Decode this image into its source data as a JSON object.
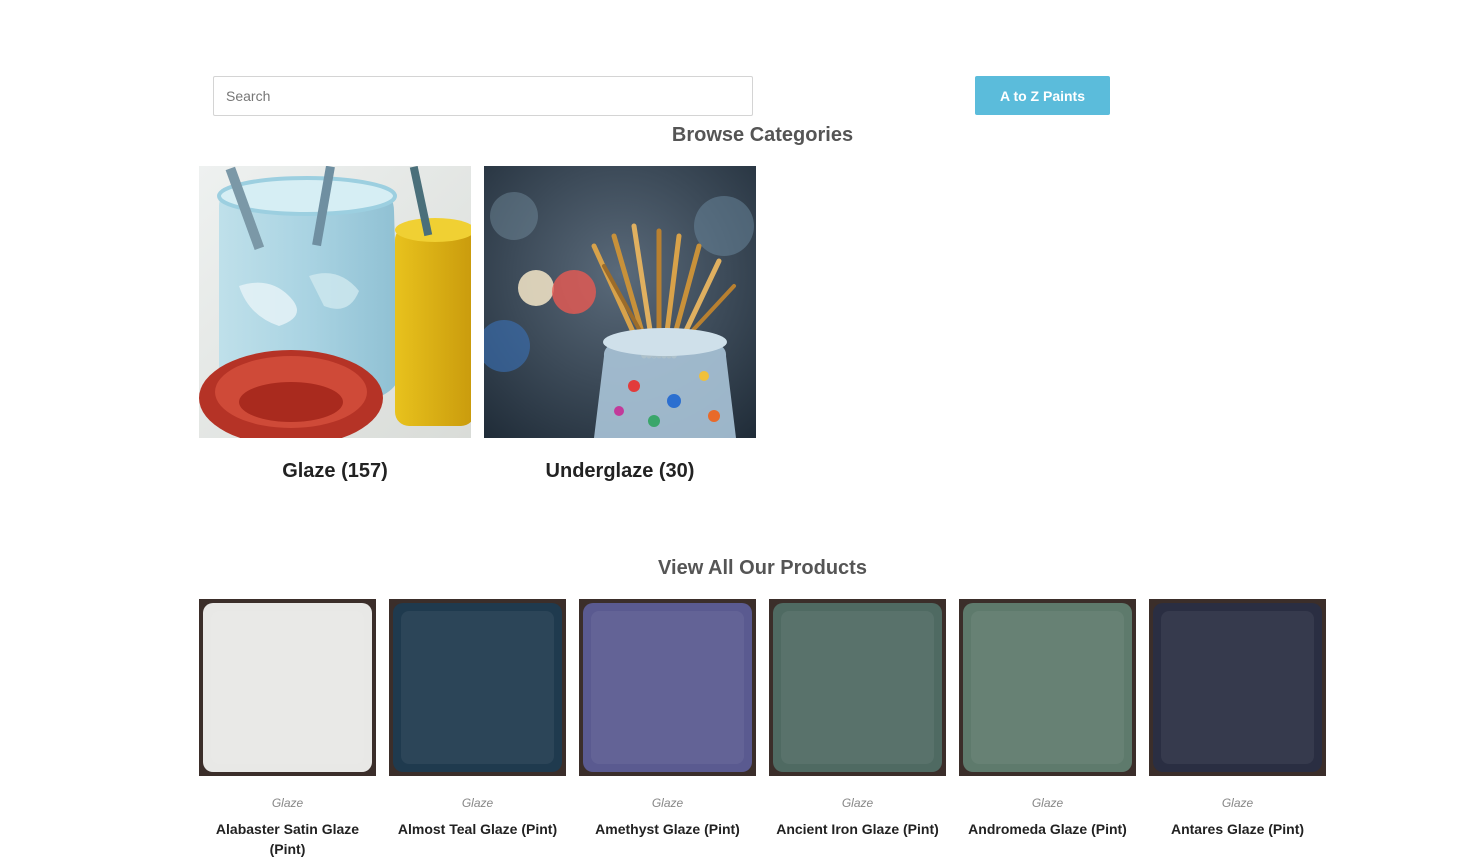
{
  "search": {
    "placeholder": "Search",
    "value": ""
  },
  "az_button": {
    "label": "A to Z Paints",
    "color": "#5bbcdb"
  },
  "browse": {
    "title": "Browse Categories",
    "categories": [
      {
        "label": "Glaze (157)",
        "image": "paint-jars-photo"
      },
      {
        "label": "Underglaze (30)",
        "image": "paint-brushes-jar-photo"
      }
    ]
  },
  "products": {
    "title": "View All Our Products",
    "items": [
      {
        "category": "Glaze",
        "name": "Alabaster Satin Glaze (Pint)",
        "swatch": "#e8e8e6"
      },
      {
        "category": "Glaze",
        "name": "Almost Teal Glaze (Pint)",
        "swatch": "#1f3a4e"
      },
      {
        "category": "Glaze",
        "name": "Amethyst Glaze (Pint)",
        "swatch": "#5a5a90"
      },
      {
        "category": "Glaze",
        "name": "Ancient Iron Glaze (Pint)",
        "swatch": "#4f6a62"
      },
      {
        "category": "Glaze",
        "name": "Andromeda Glaze (Pint)",
        "swatch": "#5e7a6c"
      },
      {
        "category": "Glaze",
        "name": "Antares Glaze (Pint)",
        "swatch": "#2a2e42"
      }
    ]
  }
}
